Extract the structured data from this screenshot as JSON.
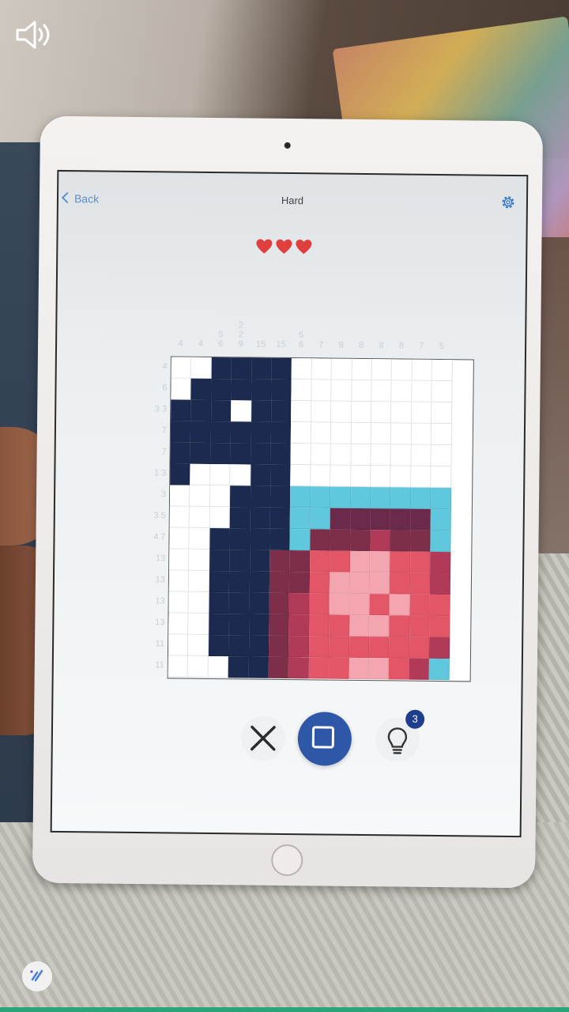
{
  "header": {
    "back_label": "Back",
    "title": "Hard"
  },
  "lives": {
    "hearts": 3,
    "color": "#e0403d"
  },
  "puzzle": {
    "column_clues": [
      [
        "4"
      ],
      [
        "4"
      ],
      [
        "5",
        "6"
      ],
      [
        "2",
        "2",
        "9"
      ],
      [
        "15"
      ],
      [
        "15"
      ],
      [
        "5",
        "6"
      ],
      [
        "7"
      ],
      [
        "8"
      ],
      [
        "8"
      ],
      [
        "8"
      ],
      [
        "8"
      ],
      [
        "7"
      ],
      [
        "5"
      ]
    ],
    "row_clues": [
      "4",
      "6",
      "3 3",
      "7",
      "7",
      "1 3",
      "3",
      "3 5",
      "4 7",
      "13",
      "13",
      "13",
      "13",
      "11",
      "11"
    ],
    "palette": {
      "N": "#1b2a4e",
      "W": "#ffffff",
      "C": "#5fc8dc",
      "P": "#6b2a4a",
      "R": "#e25668",
      "L": "#f4a6b0",
      "M": "#b13a58",
      "D": "#7d2f49"
    },
    "grid": [
      "WWNNNNWWWWWWWW",
      "WNNNNNWWWWWWWW",
      "NNNWNNWWWWWWWW",
      "NNNNNNWWWWWWWW",
      "NNNNNNWWWWWWWW",
      "NWWWNNWWWWWWWW",
      "WWWNNNCCCCCCCC",
      "WWWNNNCCPPPPPC",
      "WWNNNNCDDDMDDC",
      "WWNNNDDRRLLRRM",
      "WWNNNDDRLLLRRM",
      "WWNNNDMRLLRLRR",
      "WWNNNDMRRLLRRR",
      "WWNNNDMRRRRRRM",
      "WWWNNDMRRLLRMC"
    ]
  },
  "tools": {
    "hint_count": "3",
    "accent": "#2f57a8"
  }
}
